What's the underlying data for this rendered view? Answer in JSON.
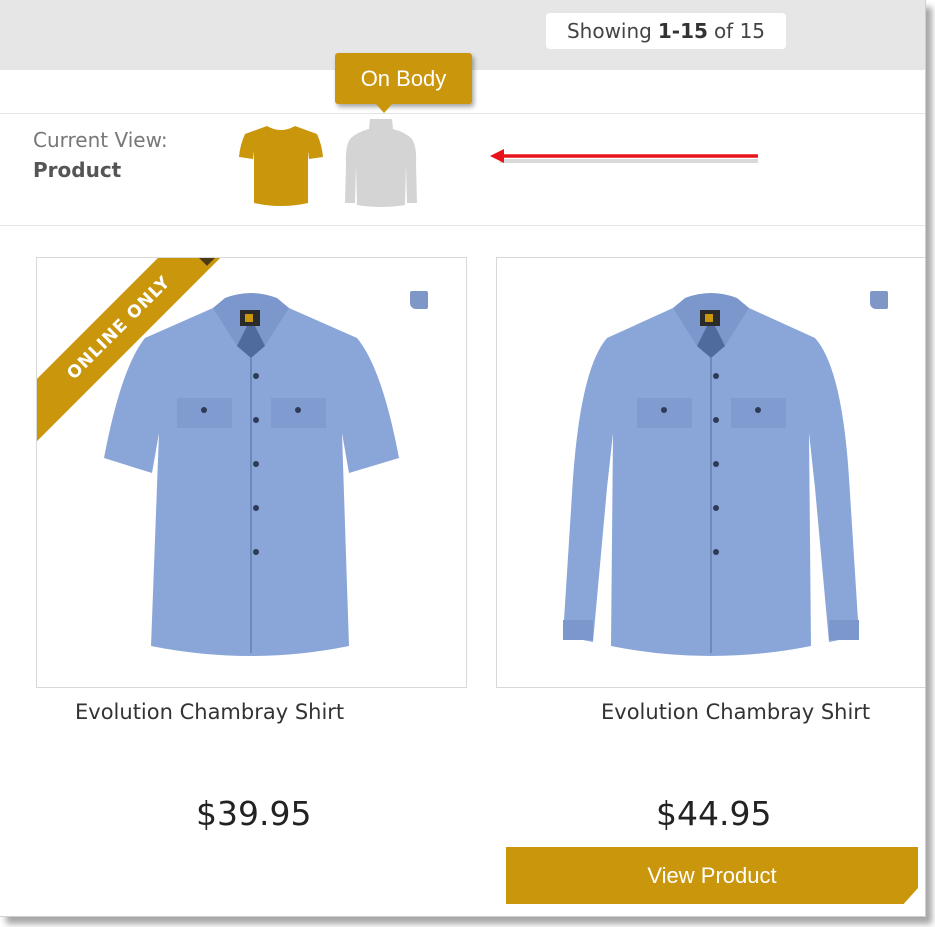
{
  "results": {
    "prefix": "Showing",
    "range": "1-15",
    "suffix": "of 15"
  },
  "view": {
    "label": "Current View:",
    "value": "Product",
    "options": [
      {
        "name": "Product",
        "icon": "tshirt-icon",
        "color": "#c9960c",
        "active": true
      },
      {
        "name": "On Body",
        "icon": "on-body-shirt-icon",
        "color": "#d4d4d4",
        "active": false
      }
    ],
    "tooltip": "On Body"
  },
  "annotation": {
    "color": "#e8141b"
  },
  "products": [
    {
      "name": "Evolution Chambray Shirt",
      "price": "$39.95",
      "badge": "ONLINE ONLY",
      "sleeve": "short",
      "swatch_color": "#7f97c6"
    },
    {
      "name": "Evolution Chambray Shirt",
      "price": "$44.95",
      "sleeve": "long",
      "swatch_color": "#7f97c6",
      "cta": "View Product"
    }
  ],
  "colors": {
    "accent": "#c9960c",
    "shirt": "#8aa6d9"
  }
}
